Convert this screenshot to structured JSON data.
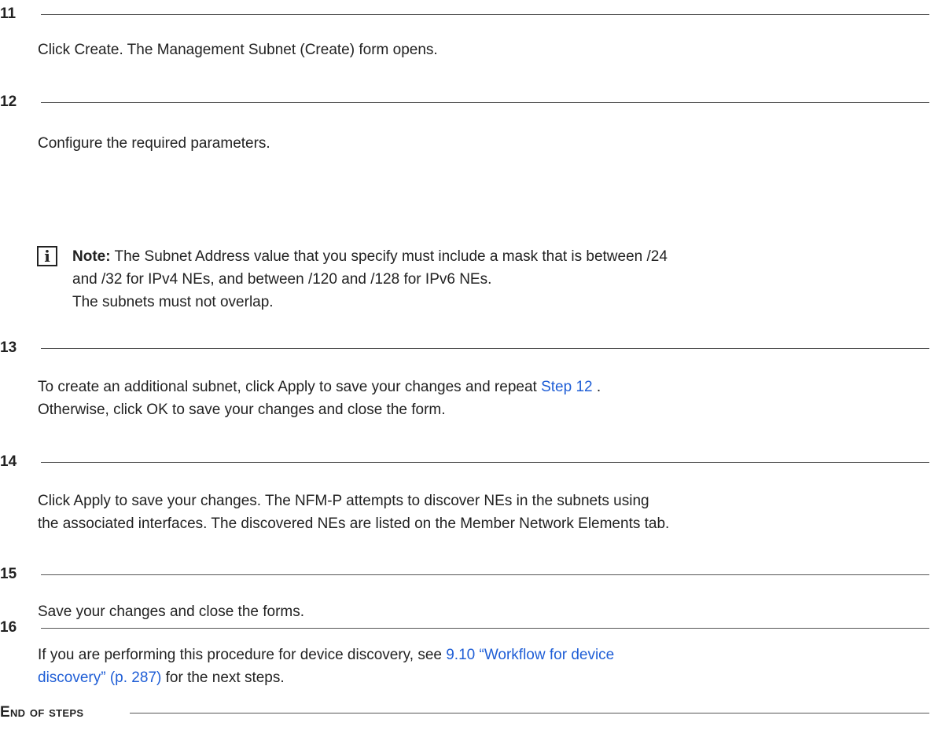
{
  "steps": [
    {
      "number": "11",
      "text": "Click Create. The Management Subnet (Create) form opens."
    },
    {
      "number": "12",
      "text": "Configure the required parameters.",
      "note": {
        "label": "Note:",
        "line1": "The Subnet Address value that you specify must include a mask that is between /24",
        "line2": "and /32 for IPv4 NEs, and between /120 and /128 for IPv6 NEs.",
        "line3": "The subnets must not overlap.",
        "icon": "info-icon"
      }
    },
    {
      "number": "13",
      "line1_pre": "To create an additional subnet, click Apply to save your changes and repeat",
      "line1_link": "Step 12",
      "line1_post": ".",
      "line2": "Otherwise, click OK to save your changes and close the form."
    },
    {
      "number": "14",
      "line1": "Click Apply to save your changes. The NFM-P attempts to discover NEs in the subnets using",
      "line2": "the associated interfaces. The discovered NEs are listed on the Member Network Elements tab."
    },
    {
      "number": "15",
      "text": "Save your changes and close the forms."
    },
    {
      "number": "16",
      "line1_pre": "If you are performing this procedure for device discovery, see",
      "link_part1": "9.10 “Workflow for device",
      "link_part2": "discovery” (p. 287)",
      "line2_post": "for the next steps."
    }
  ],
  "end_label": "End of steps",
  "colors": {
    "text": "#222222",
    "link": "#1f5ed6",
    "rule": "#555555"
  }
}
